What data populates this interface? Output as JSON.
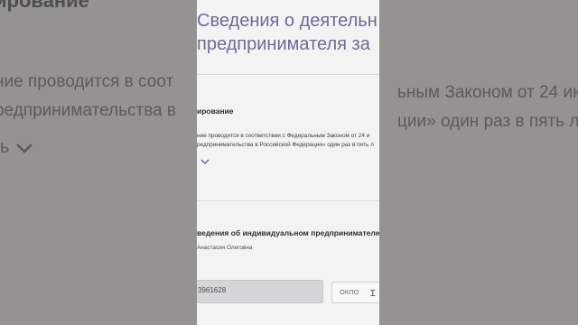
{
  "background": {
    "line1": "ирование",
    "line2": "ние проводится в соот",
    "line3": "редпринимательства в",
    "right1": "ьным Законом от 24 ию",
    "right2": "ции» один раз в пять л",
    "chev_prefix": "ь"
  },
  "title": {
    "line1": "Сведения о деятельн",
    "line2": "предпринимателя за"
  },
  "monitoring": {
    "heading": "ирование",
    "body_line1": "ние проводится в соответствии с Федеральным Законом от 24 и",
    "body_line2": "редпринимательства в Российской Федерации» один раз в пять л"
  },
  "entrepreneur": {
    "heading": "ведения об индивидуальном предпринимателе",
    "name": "Анастасия Олеговна",
    "inn_value": "3961628",
    "okpo_label": "ОКПО"
  },
  "icons": {
    "expand": "chevron-down-icon",
    "cursor": "text-cursor-icon"
  },
  "colors": {
    "title": "#6f6a96",
    "chevron": "#5a5aa0"
  }
}
